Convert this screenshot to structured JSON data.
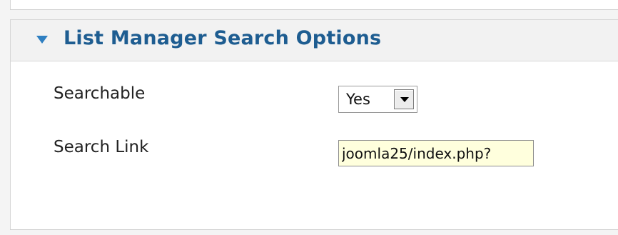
{
  "panel": {
    "title": "List Manager Search Options"
  },
  "fields": {
    "searchable": {
      "label": "Searchable",
      "value": "Yes"
    },
    "search_link": {
      "label": "Search Link",
      "value": "joomla25/index.php?"
    }
  },
  "colors": {
    "title": "#1e5d91",
    "arrow": "#2f7fc1",
    "input_background": "#ffffdd"
  },
  "icons": {
    "toggle": "triangle-down-icon",
    "select": "dropdown-arrow-icon"
  }
}
